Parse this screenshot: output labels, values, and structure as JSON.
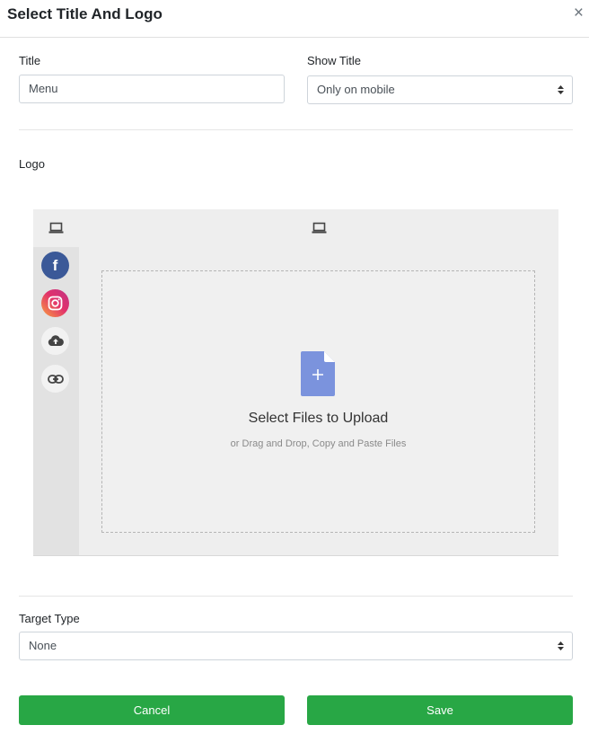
{
  "modal": {
    "title": "Select Title And Logo",
    "close_symbol": "×"
  },
  "form": {
    "title_label": "Title",
    "title_value": "Menu",
    "show_title_label": "Show Title",
    "show_title_value": "Only on mobile",
    "logo_label": "Logo",
    "target_type_label": "Target Type",
    "target_type_value": "None"
  },
  "uploader": {
    "tab_icon": "laptop-icon",
    "header_icon": "laptop-icon",
    "sources": [
      "facebook-icon",
      "instagram-icon",
      "cloud-upload-icon",
      "link-icon"
    ],
    "title": "Select Files to Upload",
    "subtitle": "or Drag and Drop, Copy and Paste Files"
  },
  "buttons": {
    "cancel": "Cancel",
    "save": "Save"
  },
  "colors": {
    "button": "#28a745",
    "facebook": "#3b5998",
    "file_icon": "#7b93dd",
    "uploader_bg": "#eeeeee"
  }
}
